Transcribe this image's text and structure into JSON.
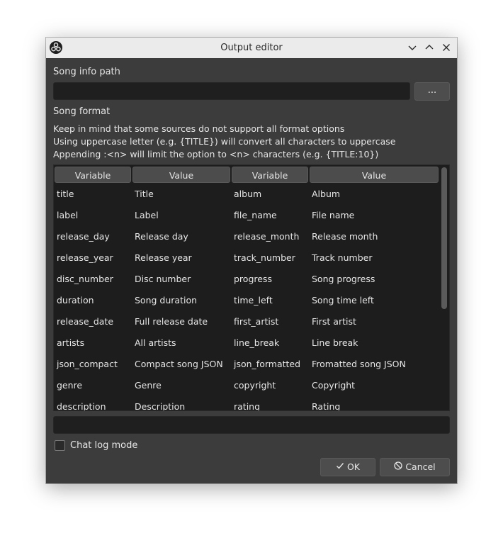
{
  "window": {
    "title": "Output editor",
    "app_icon": "obs-logo-icon",
    "controls": [
      "chevron-down-icon",
      "chevron-up-icon",
      "close-icon"
    ]
  },
  "song_info": {
    "label": "Song info path",
    "path_value": "",
    "browse_label": "..."
  },
  "song_format": {
    "label": "Song format",
    "info_lines": [
      "Keep in mind that some sources do not support all format options",
      "Using uppercase letter (e.g. {TITLE}) will convert all characters to uppercase",
      "Appending :<n> will limit the option to <n> characters (e.g. {TITLE:10})"
    ]
  },
  "table": {
    "headers": [
      "Variable",
      "Value",
      "Variable",
      "Value"
    ],
    "rows": [
      [
        "title",
        "Title",
        "album",
        "Album"
      ],
      [
        "label",
        "Label",
        "file_name",
        "File name"
      ],
      [
        "release_day",
        "Release day",
        "release_month",
        "Release month"
      ],
      [
        "release_year",
        "Release year",
        "track_number",
        "Track number"
      ],
      [
        "disc_number",
        "Disc number",
        "progress",
        "Song progress"
      ],
      [
        "duration",
        "Song duration",
        "time_left",
        "Song time left"
      ],
      [
        "release_date",
        "Full release date",
        "first_artist",
        "First artist"
      ],
      [
        "artists",
        "All artists",
        "line_break",
        "Line break"
      ],
      [
        "json_compact",
        "Compact song JSON",
        "json_formatted",
        "Fromatted song JSON"
      ],
      [
        "genre",
        "Genre",
        "copyright",
        "Copyright"
      ],
      [
        "description",
        "Description",
        "rating",
        "Rating"
      ]
    ]
  },
  "format_preview": {
    "value": ""
  },
  "chat_log": {
    "label": "Chat log mode",
    "checked": false
  },
  "buttons": {
    "ok": {
      "label": "OK",
      "icon": "check-icon"
    },
    "cancel": {
      "label": "Cancel",
      "icon": "cancel-circle-icon"
    }
  }
}
